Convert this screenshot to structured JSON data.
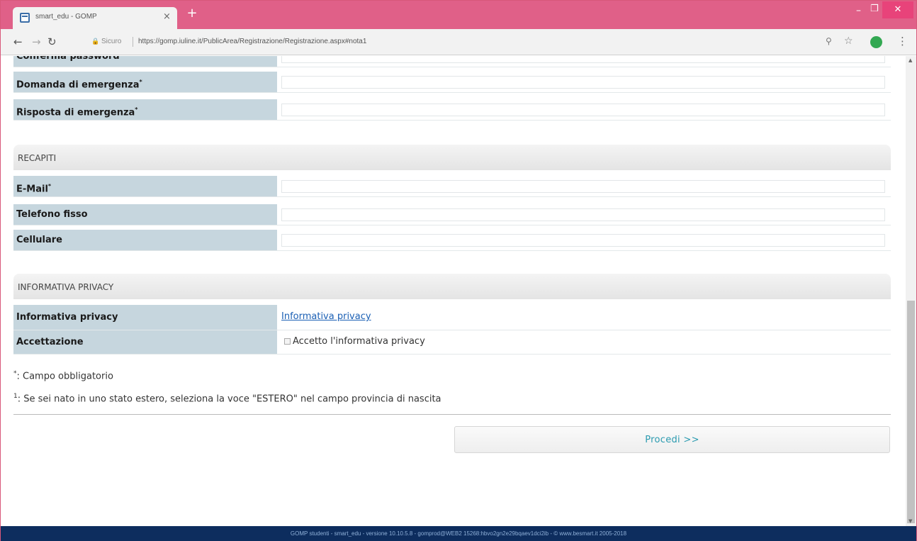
{
  "browser": {
    "tab_title": "smart_edu - GOMP",
    "tab_close": "×",
    "new_tab": "+",
    "secure_label": "Sicuro",
    "url": "https://gomp.iuline.it/PublicArea/Registrazione/Registrazione.aspx#nota1",
    "icons": [
      "back-arrow-icon",
      "forward-arrow-icon",
      "reload-icon",
      "lock-icon",
      "zoom-icon",
      "star-icon",
      "profile-icon",
      "menu-icon"
    ]
  },
  "form": {
    "top_partial_label": "Conferma password",
    "rows_top": [
      {
        "label": "Domanda di emergenza",
        "required_mark": "*"
      },
      {
        "label": "Risposta di emergenza",
        "required_mark": "*"
      }
    ],
    "recapiti": {
      "heading": "RECAPITI",
      "rows": [
        {
          "label": "E-Mail",
          "required_mark": "*"
        },
        {
          "label": "Telefono fisso",
          "required_mark": ""
        },
        {
          "label": "Cellulare",
          "required_mark": ""
        }
      ]
    },
    "privacy": {
      "heading": "INFORMATIVA PRIVACY",
      "info_label": "Informativa privacy",
      "info_link": "Informativa privacy",
      "accept_label": "Accettazione",
      "accept_checkbox_label": "Accetto l'informativa privacy",
      "accept_checked": false
    }
  },
  "notes": {
    "required_mark": "*",
    "required_text": ": Campo obbligatorio",
    "foreign_mark": "1",
    "foreign_text": ": Se sei nato in uno stato estero, seleziona la voce \"ESTERO\" nel campo provincia di nascita"
  },
  "actions": {
    "proceed_label": "Procedi >>"
  },
  "footer": {
    "text": "GOMP studenti - smart_edu - versione 10.10.5.8 - gomprod@WEB2 15268:hbvo2gn2e29bqaev1dci2ib - © www.besmart.it 2005-2018"
  },
  "colors": {
    "titlebar": "#e06088",
    "label_cell": "#c6d6de",
    "button_text": "#2b9bb0",
    "footer": "#0d2d5e"
  }
}
